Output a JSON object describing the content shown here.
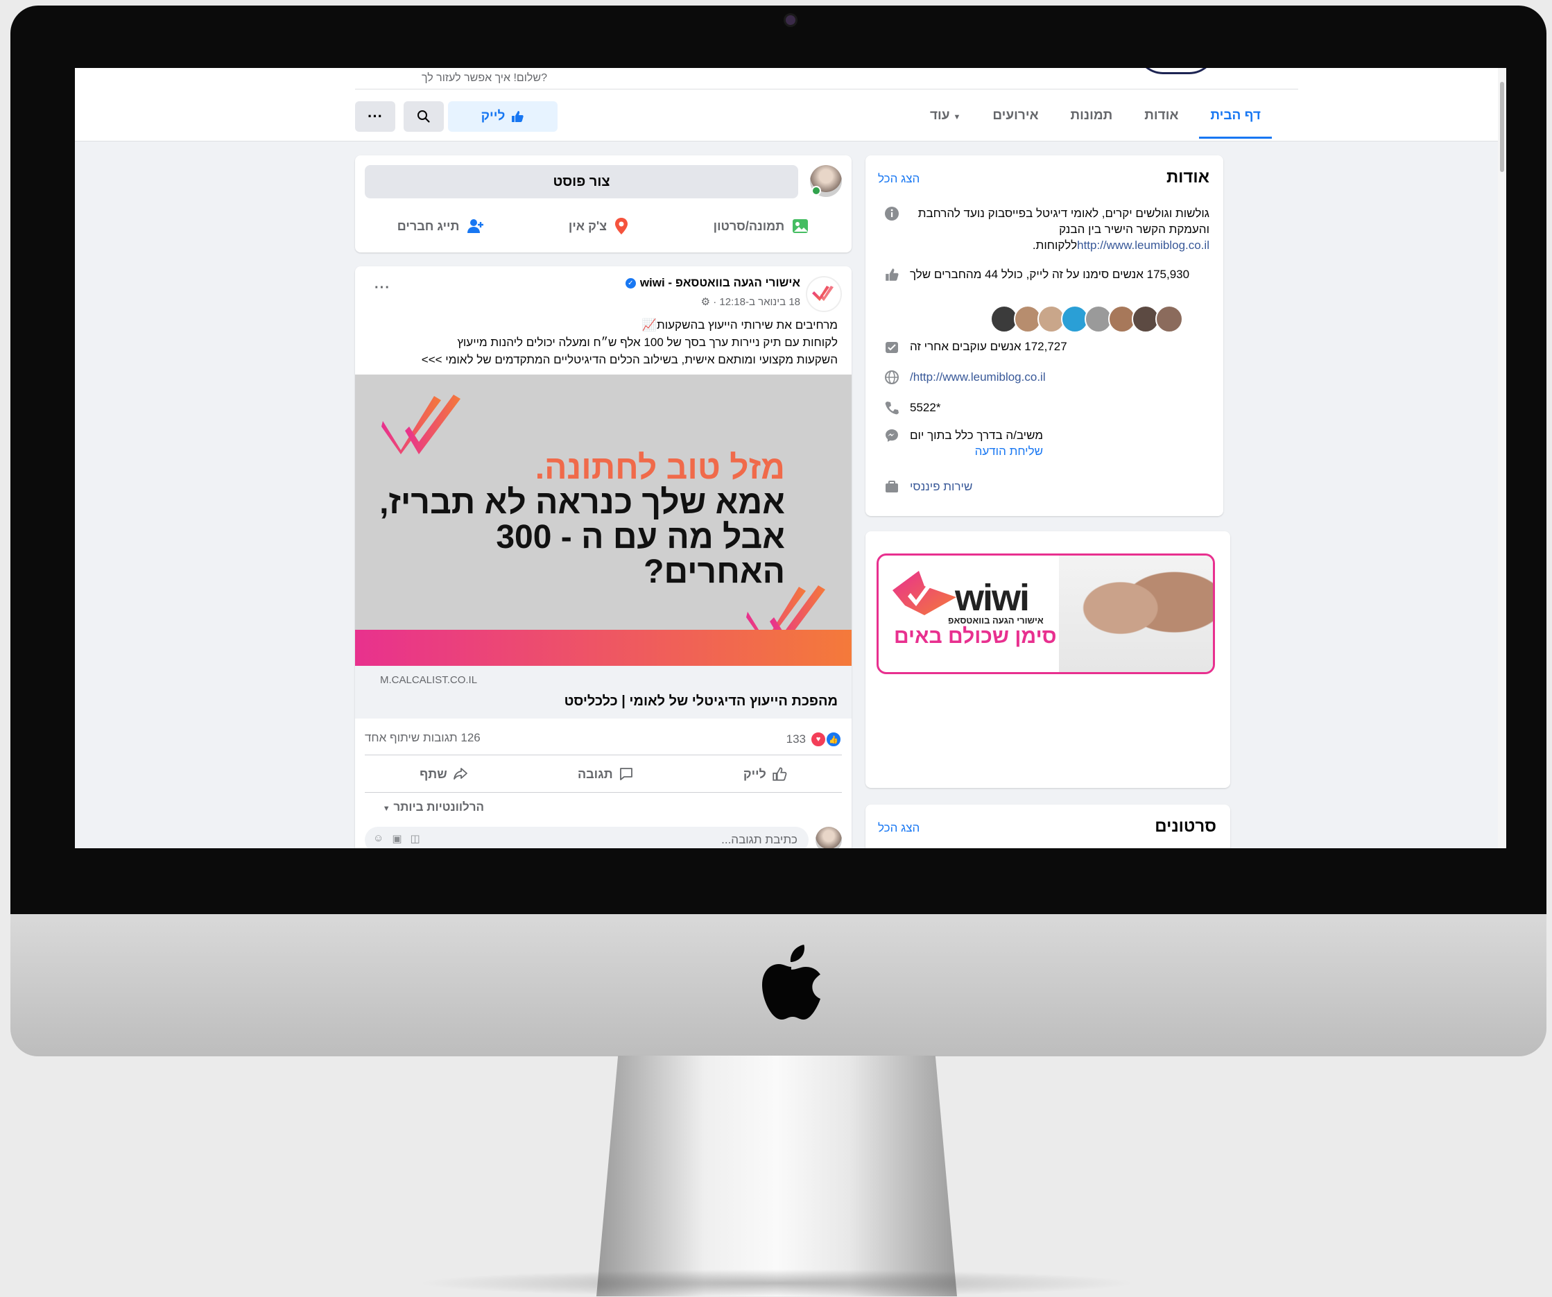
{
  "topbar": {
    "greeting": "שלום! איך אפשר לעזור לך?",
    "tabs": [
      {
        "label": "דף הבית",
        "active": true
      },
      {
        "label": "אודות"
      },
      {
        "label": "תמונות"
      },
      {
        "label": "אירועים"
      },
      {
        "label": "עוד"
      }
    ],
    "like_label": "לייק"
  },
  "composer": {
    "placeholder": "צור פוסט",
    "actions": [
      {
        "label": "תמונה/סרטון",
        "icon": "photo-icon"
      },
      {
        "label": "צ'ק אין",
        "icon": "location-pin-icon"
      },
      {
        "label": "תייג חברים",
        "icon": "tag-friends-icon"
      }
    ]
  },
  "post": {
    "author": "wiwi - אישורי הגעה בוואטסאפ",
    "meta": "18 בינואר ב-12:18 ·",
    "text_lines": [
      "מרחיבים את שירותי הייעוץ בהשקעות📈",
      "לקוחות עם תיק ניירות ערך בסך של 100 אלף ש״ח ומעלה יכולים ליהנות מייעוץ",
      "השקעות מקצועי ומותאם אישית, בשילוב הכלים הדיגיטליים המתקדמים של לאומי >>>"
    ],
    "image": {
      "headline_accent": "מזל טוב לחתונה.",
      "headline_line2": "אמא שלך כנראה לא תבריז,",
      "headline_line3": "אבל מה עם ה - 300 האחרים?"
    },
    "link": {
      "domain": "M.CALCALIST.CO.IL",
      "title": "מהפכת הייעוץ הדיגיטלי של לאומי | כלכליסט"
    },
    "reactions_count": "133",
    "comments_shares": "126 תגובות  שיתוף אחד",
    "actions": [
      {
        "label": "לייק",
        "icon": "thumbs-up-icon"
      },
      {
        "label": "תגובה",
        "icon": "comment-icon"
      },
      {
        "label": "שתף",
        "icon": "share-icon"
      }
    ],
    "sort_label": "הרלוונטיות ביותר",
    "comment_placeholder": "כתיבת תגובה..."
  },
  "about": {
    "title": "אודות",
    "see_all": "הצג הכל",
    "description": "גולשות וגולשים יקרים, לאומי דיגיטל בפייסבוק נועד להרחבת והעמקת הקשר הישיר בין הבנק",
    "description_link": "http://www.leumiblog.co.il",
    "description_tail": "ללקוחות.",
    "likes": "175,930 אנשים סימנו על זה לייק, כולל 44 מהחברים שלך",
    "followers": "172,727 אנשים עוקבים אחרי זה",
    "website": "http://www.leumiblog.co.il/",
    "phone": "*5522",
    "response": "משיב/ה בדרך כלל בתוך יום",
    "send_message": "שליחת הודעה",
    "category": "שירות פיננסי"
  },
  "ad": {
    "brand": "wiwi",
    "subtitle": "אישורי הגעה בוואטסאפ",
    "tagline": "סימן שכולם באים"
  },
  "videos": {
    "title": "סרטונים",
    "see_all": "הצג הכל"
  },
  "colors": {
    "facebook_blue": "#1877f2",
    "brand_pink": "#e8308f",
    "brand_orange": "#f47a3a"
  }
}
